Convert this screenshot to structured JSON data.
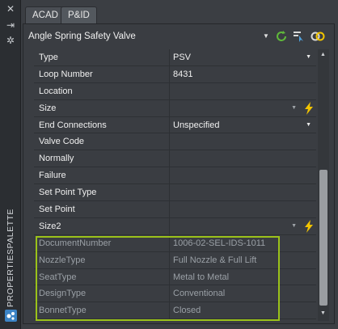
{
  "tabs": [
    "ACAD",
    "P&ID"
  ],
  "header": {
    "title": "Angle Spring Safety Valve",
    "icons": [
      "refresh-icon",
      "select-objects-icon",
      "link-icon"
    ]
  },
  "palette": {
    "title": "PROPERTIESPALETTE",
    "strip_icons": [
      "close-icon",
      "pin-icon",
      "settings-icon"
    ]
  },
  "properties": [
    {
      "name": "Type",
      "value": "PSV",
      "dropdown": true
    },
    {
      "name": "Loop Number",
      "value": "8431"
    },
    {
      "name": "Location",
      "value": ""
    },
    {
      "name": "Size",
      "value": "",
      "bolt": true
    },
    {
      "name": "End Connections",
      "value": "Unspecified",
      "dropdown": true
    },
    {
      "name": "Valve Code",
      "value": ""
    },
    {
      "name": "Normally",
      "value": ""
    },
    {
      "name": "Failure",
      "value": ""
    },
    {
      "name": "Set Point Type",
      "value": ""
    },
    {
      "name": "Set Point",
      "value": ""
    },
    {
      "name": "Size2",
      "value": "",
      "bolt": true
    },
    {
      "name": "DocumentNumber",
      "value": "1006-02-SEL-IDS-1011",
      "readonly": true
    },
    {
      "name": "NozzleType",
      "value": "Full Nozzle & Full Lift",
      "readonly": true
    },
    {
      "name": "SeatType",
      "value": "Metal to Metal",
      "readonly": true
    },
    {
      "name": "DesignType",
      "value": "Conventional",
      "readonly": true
    },
    {
      "name": "BonnetType",
      "value": "Closed",
      "readonly": true
    }
  ],
  "colors": {
    "highlight": "#9bc21a",
    "bolt": "#f2c400",
    "refresh": "#5fb83a"
  }
}
